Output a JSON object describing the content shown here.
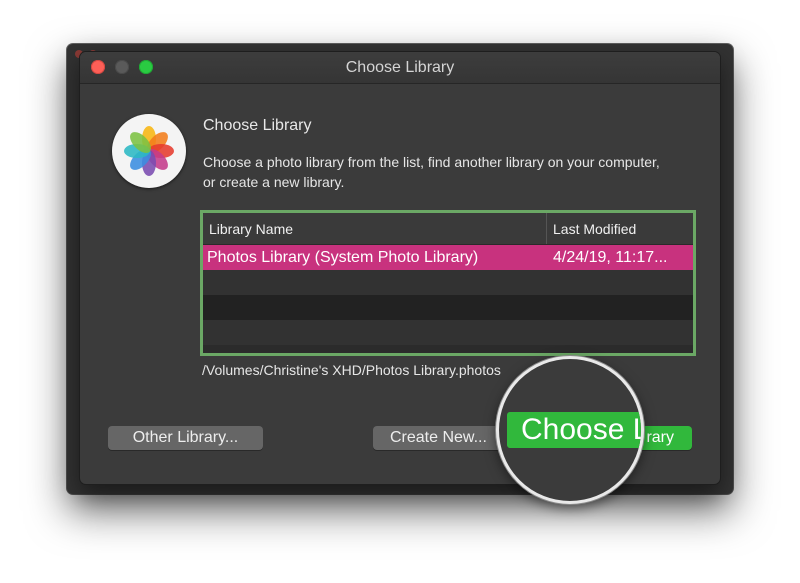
{
  "window": {
    "title": "Choose Library"
  },
  "dialog": {
    "heading": "Choose Library",
    "description": "Choose a photo library from the list, find another library on your computer, or create a new library."
  },
  "table": {
    "columns": [
      "Library Name",
      "Last Modified"
    ],
    "rows": [
      {
        "name": "Photos Library (System Photo Library)",
        "modified": "4/24/19, 11:17..."
      }
    ]
  },
  "path": "/Volumes/Christine's XHD/Photos Library.photos",
  "buttons": {
    "other_library": "Other Library...",
    "create_new": "Create New...",
    "choose_library": "Choose Library",
    "choose_library_suffix": "rary",
    "magnified_label": "Choose Li"
  },
  "colors": {
    "selection": "#c8327e",
    "highlight_border": "#6ba865",
    "primary_button": "#31b83c"
  }
}
